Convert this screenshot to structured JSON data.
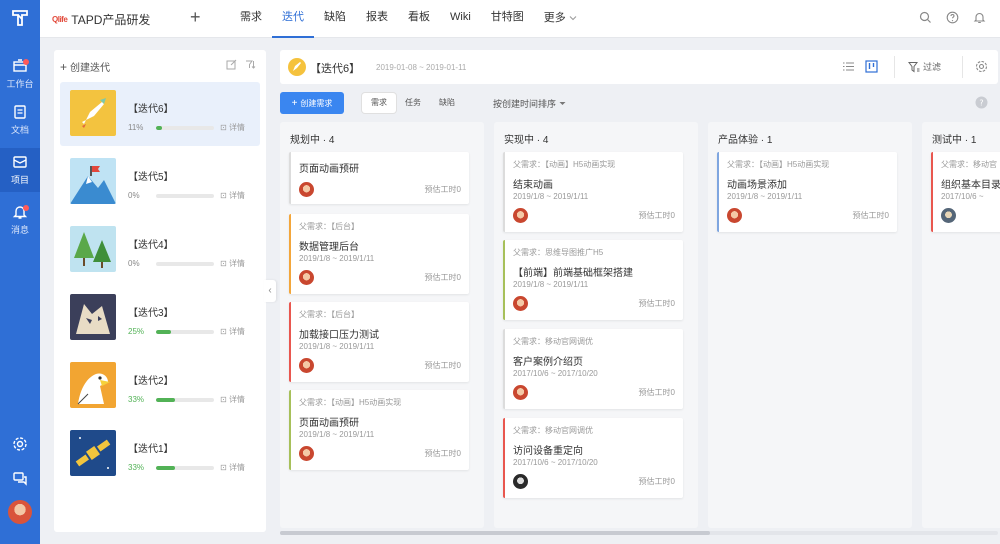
{
  "app": {
    "brand_mark": "Qlife",
    "title": "TAPD产品研发"
  },
  "nav": {
    "items": [
      "需求",
      "迭代",
      "缺陷",
      "报表",
      "看板",
      "Wiki",
      "甘特图"
    ],
    "active_index": 1,
    "more": "更多"
  },
  "rail": {
    "items": [
      {
        "label": "工作台",
        "icon": "workbench-icon",
        "badge": true
      },
      {
        "label": "文档",
        "icon": "document-icon",
        "badge": false
      },
      {
        "label": "项目",
        "icon": "project-icon",
        "badge": false,
        "active": true
      },
      {
        "label": "消息",
        "icon": "bell-icon",
        "badge": true
      }
    ]
  },
  "iterations": {
    "create_label": "创建迭代",
    "detail_label": "详情",
    "items": [
      {
        "name": "【迭代6】",
        "progress_text": "11%",
        "progress": 0.11,
        "thumb": "rocket",
        "active": true
      },
      {
        "name": "【迭代5】",
        "progress_text": "0%",
        "progress": 0.0,
        "thumb": "mountain"
      },
      {
        "name": "【迭代4】",
        "progress_text": "0%",
        "progress": 0.0,
        "thumb": "trees"
      },
      {
        "name": "【迭代3】",
        "progress_text": "25%",
        "progress": 0.25,
        "thumb": "wolf"
      },
      {
        "name": "【迭代2】",
        "progress_text": "33%",
        "progress": 0.33,
        "thumb": "eagle"
      },
      {
        "name": "【迭代1】",
        "progress_text": "33%",
        "progress": 0.33,
        "thumb": "satellite"
      }
    ]
  },
  "sprint": {
    "title": "【迭代6】",
    "dates": "2019-01-08 ~ 2019-01-11",
    "filter_label": "过滤"
  },
  "toolbar": {
    "create_label": "创建需求",
    "tabs": [
      "需求",
      "任务",
      "缺陷"
    ],
    "active_tab": 0,
    "sort_label": "按创建时间排序"
  },
  "columns": [
    {
      "title": "规划中 · 4",
      "tasks": [
        {
          "parent": "",
          "title": "页面动画预研",
          "date": "",
          "est": "预估工时0",
          "avatar": "av1",
          "color": "gray"
        },
        {
          "parent": "父需求：【后台】",
          "title": "数据管理后台",
          "date": "2019/1/8 ~ 2019/1/11",
          "est": "预估工时0",
          "avatar": "av1",
          "color": "orange"
        },
        {
          "parent": "父需求：【后台】",
          "title": "加载接口压力测试",
          "date": "2019/1/8 ~ 2019/1/11",
          "est": "预估工时0",
          "avatar": "av1",
          "color": "red"
        },
        {
          "parent": "父需求：【动画】H5动画实现",
          "title": "页面动画预研",
          "date": "2019/1/8 ~ 2019/1/11",
          "est": "预估工时0",
          "avatar": "av1",
          "color": "olive"
        }
      ]
    },
    {
      "title": "实现中 · 4",
      "tasks": [
        {
          "parent": "父需求：【动画】H5动画实现",
          "title": "结束动画",
          "date": "2019/1/8 ~ 2019/1/11",
          "est": "预估工时0",
          "avatar": "av1",
          "color": "gray"
        },
        {
          "parent": "父需求：思维导图推广H5",
          "title": "【前端】前端基础框架搭建",
          "date": "2019/1/8 ~ 2019/1/11",
          "est": "预估工时0",
          "avatar": "av1",
          "color": "olive"
        },
        {
          "parent": "父需求：移动官网调优",
          "title": "客户案例介绍页",
          "date": "2017/10/6 ~ 2017/10/20",
          "est": "预估工时0",
          "avatar": "av1",
          "color": "gray"
        },
        {
          "parent": "父需求：移动官网调优",
          "title": "访问设备重定向",
          "date": "2017/10/6 ~ 2017/10/20",
          "est": "预估工时0",
          "avatar": "av2",
          "color": "red"
        }
      ]
    },
    {
      "title": "产品体验 · 1",
      "tasks": [
        {
          "parent": "父需求：【动画】H5动画实现",
          "title": "动画场景添加",
          "date": "2019/1/8 ~ 2019/1/11",
          "est": "预估工时0",
          "avatar": "av1",
          "color": "blue"
        }
      ]
    },
    {
      "title": "测试中 · 1",
      "tasks": [
        {
          "parent": "父需求：移动官",
          "title": "组织基本目录",
          "date": "2017/10/6 ~",
          "est": "",
          "avatar": "av3",
          "color": "red"
        }
      ]
    }
  ]
}
